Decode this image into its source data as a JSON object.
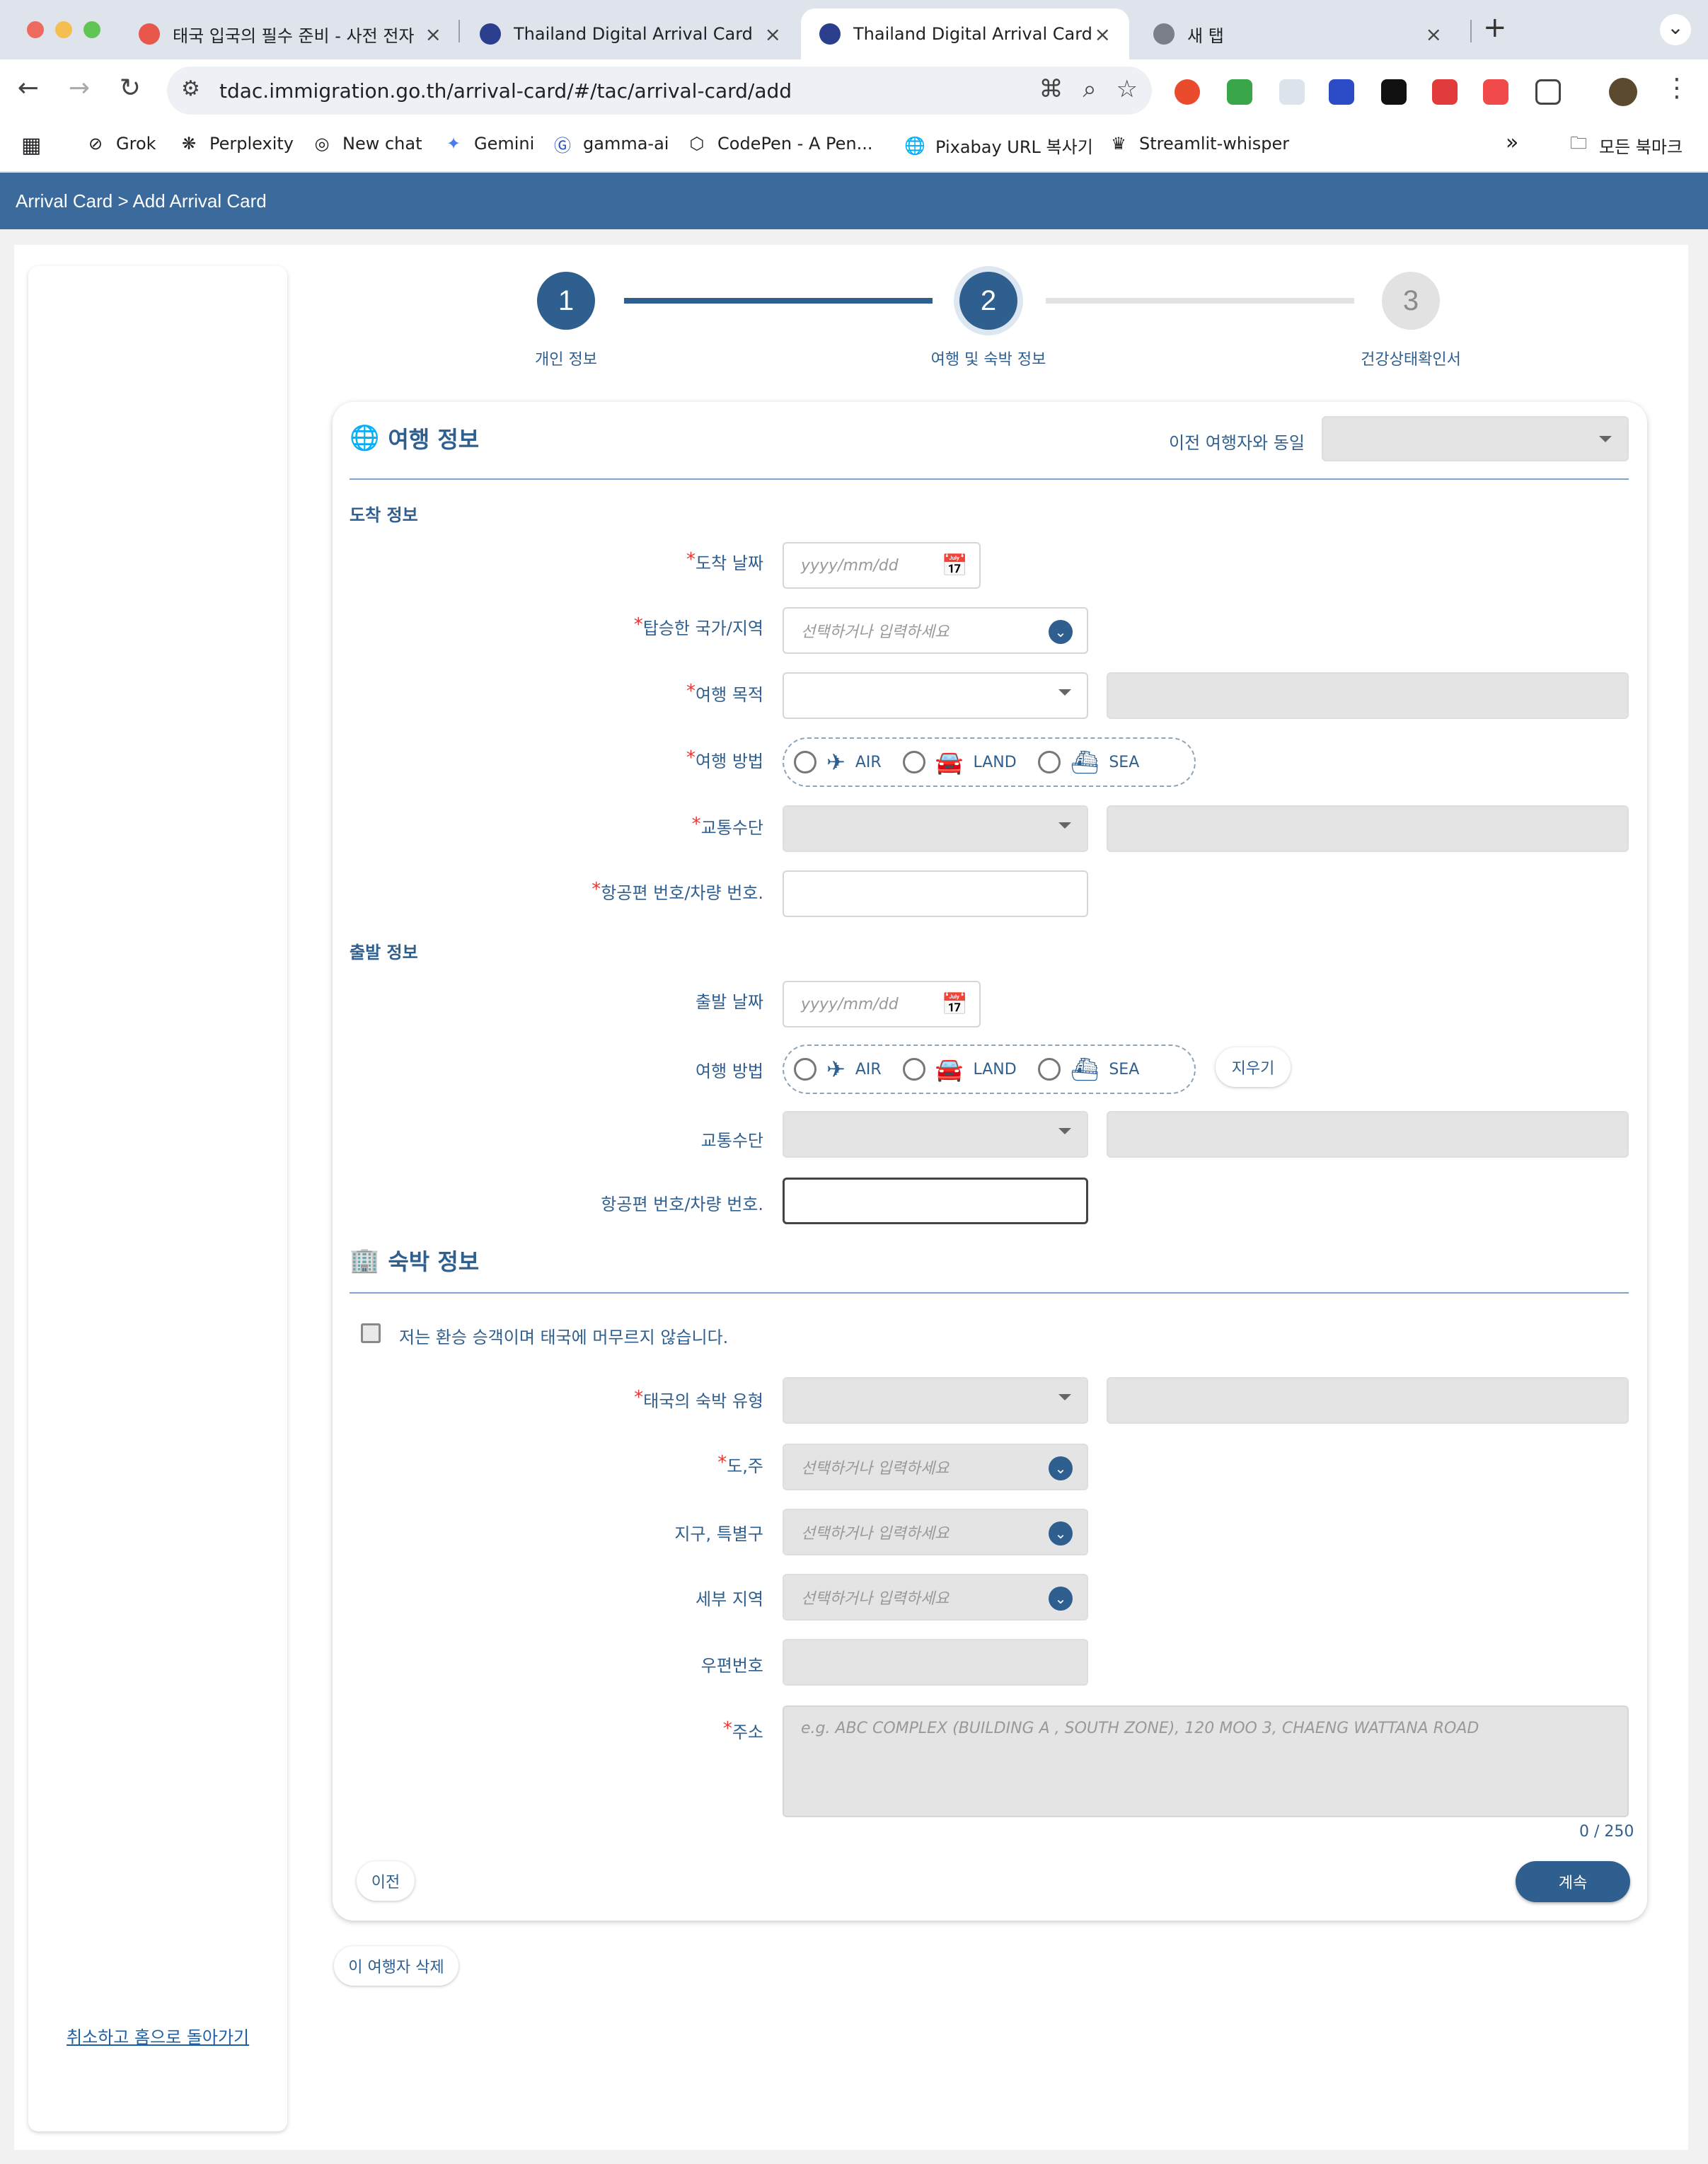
{
  "browser": {
    "tabs": [
      {
        "title": "태국 입국의 필수 준비 - 사전 전자",
        "fav_color": "#e8574c",
        "close": "×"
      },
      {
        "title": "Thailand Digital Arrival Card",
        "fav_color": "#2c3f8f",
        "close": "×"
      },
      {
        "title": "Thailand Digital Arrival Card",
        "fav_color": "#2c3f8f",
        "close": "×"
      },
      {
        "title": "새 탭",
        "fav_color": "#7a7f87",
        "close": "×"
      }
    ],
    "new_tab": "+",
    "tab_menu": "⌄",
    "url": "tdac.immigration.go.th/arrival-card/#/tac/arrival-card/add",
    "bookmarks": [
      {
        "label": "Grok",
        "icon": "grok-icon",
        "glyph": "⊘"
      },
      {
        "label": "Perplexity",
        "icon": "perplexity-icon",
        "glyph": "❋"
      },
      {
        "label": "New chat",
        "icon": "openai-icon",
        "glyph": "◎"
      },
      {
        "label": "Gemini",
        "icon": "gemini-icon",
        "glyph": "✦"
      },
      {
        "label": "gamma-ai",
        "icon": "gamma-icon",
        "glyph": "Ⓖ"
      },
      {
        "label": "CodePen - A Pen...",
        "icon": "codepen-icon",
        "glyph": "⬡"
      },
      {
        "label": "Pixabay URL 복사기",
        "icon": "globe-icon",
        "glyph": "🌐"
      },
      {
        "label": "Streamlit-whisper",
        "icon": "streamlit-icon",
        "glyph": "♛"
      }
    ],
    "bookmarks_overflow": "»",
    "all_bookmarks": "모든 북마크"
  },
  "page": {
    "breadcrumb": "Arrival Card > Add Arrival Card",
    "cancel_link": "취소하고 홈으로 돌아가기"
  },
  "stepper": [
    {
      "number": "1",
      "label": "개인 정보",
      "state": "done"
    },
    {
      "number": "2",
      "label": "여행 및 숙박 정보",
      "state": "active"
    },
    {
      "number": "3",
      "label": "건강상태확인서",
      "state": "pending"
    }
  ],
  "travel": {
    "title": "여행 정보",
    "same_as_label": "이전 여행자와 동일",
    "arrival_heading": "도착 정보",
    "departure_heading": "출발 정보",
    "arrival_date_label": "도착 날짜",
    "boarded_country_label": "탑승한 국가/지역",
    "purpose_label": "여행 목적",
    "travel_mode_label": "여행 방법",
    "transport_label": "교통수단",
    "flight_label": "항공편 번호/차량 번호.",
    "departure_date_label": "출발 날짜",
    "date_placeholder": "yyyy/mm/dd",
    "select_placeholder": "선택하거나 입력하세요",
    "modes": [
      "AIR",
      "LAND",
      "SEA"
    ],
    "clear_button": "지우기"
  },
  "accommodation": {
    "title": "숙박 정보",
    "transit_checkbox": "저는 환승 승객이며 태국에 머무르지 않습니다.",
    "type_label": "태국의 숙박 유형",
    "province_label": "도,주",
    "district_label": "지구, 특별구",
    "subdistrict_label": "세부 지역",
    "postcode_label": "우편번호",
    "address_label": "주소",
    "address_placeholder": "e.g. ABC COMPLEX (BUILDING A , SOUTH ZONE), 120 MOO 3, CHAENG WATTANA ROAD",
    "counter": "0 / 250"
  },
  "actions": {
    "prev": "이전",
    "next": "계속",
    "delete_traveler": "이 여행자 삭제"
  },
  "colors": {
    "primary": "#2f5f8f",
    "header": "#3a6b9c",
    "required": "#e53935"
  }
}
